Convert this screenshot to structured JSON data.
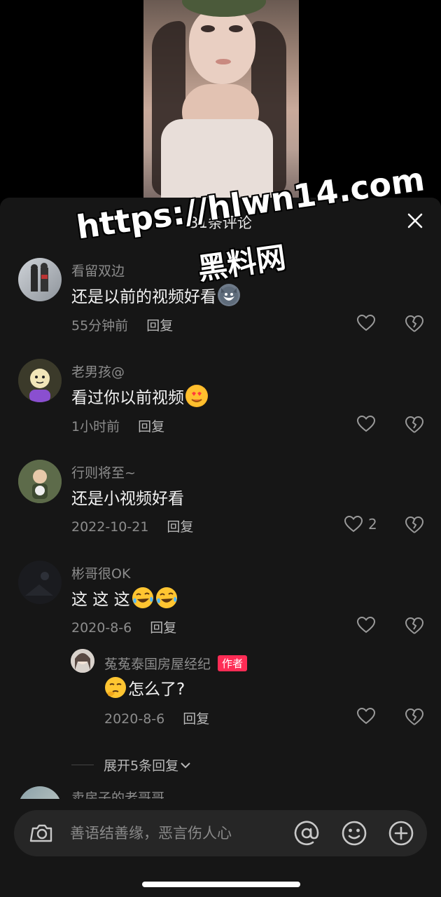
{
  "sheet": {
    "title": "31条评论",
    "close_icon": "close-icon"
  },
  "comments": [
    {
      "name": "看留双边",
      "text": "还是以前的视频好看",
      "text_emoji": "husky-emoji",
      "time": "55分钟前",
      "reply_label": "回复",
      "like_count": ""
    },
    {
      "name": "老男孩@",
      "text": "看过你以前视频",
      "text_emoji": "heart-eyes-emoji",
      "time": "1小时前",
      "reply_label": "回复",
      "like_count": ""
    },
    {
      "name": "行则将至~",
      "text": "还是小视频好看",
      "time": "2022-10-21",
      "reply_label": "回复",
      "like_count": "2"
    },
    {
      "name": "彬哥很OK",
      "text": "这 这 这",
      "text_emoji": "laughing-crying-emoji",
      "time": "2020-8-6",
      "reply_label": "回复",
      "like_count": ""
    }
  ],
  "reply": {
    "name": "菟菟泰国房屋经纪",
    "badge": "作者",
    "text": "怎么了?",
    "text_emoji": "thinking-emoji",
    "time": "2020-8-6",
    "reply_label": "回复",
    "like_count": ""
  },
  "expand_label": "展开5条回复",
  "peek_name": "卖房子的老哥哥",
  "input": {
    "placeholder": "善语结善缘，恶言伤人心"
  },
  "watermark": {
    "url": "https://hlwn14.com",
    "site": "黑料网"
  },
  "colors": {
    "sheet_bg": "#161616",
    "accent_badge": "#fe2c55",
    "muted_text": "#8c8c8c"
  }
}
